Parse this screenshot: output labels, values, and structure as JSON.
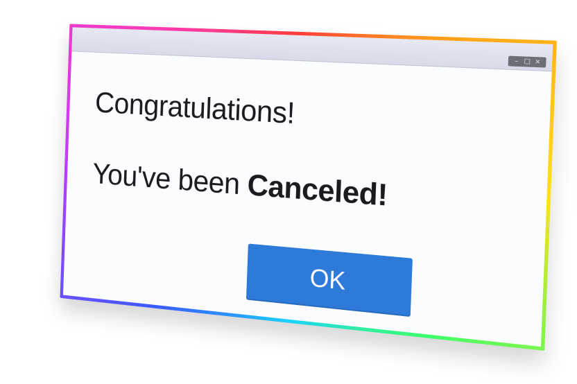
{
  "dialog": {
    "headline": "Congratulations!",
    "message_prefix": "You've been ",
    "message_emphasis": "Canceled!",
    "ok_label": "OK"
  },
  "window_controls": {
    "minimize": "–",
    "maximize": "□",
    "close": "×"
  },
  "colors": {
    "button": "#2e7ad9",
    "background": "#fbfcfe"
  }
}
